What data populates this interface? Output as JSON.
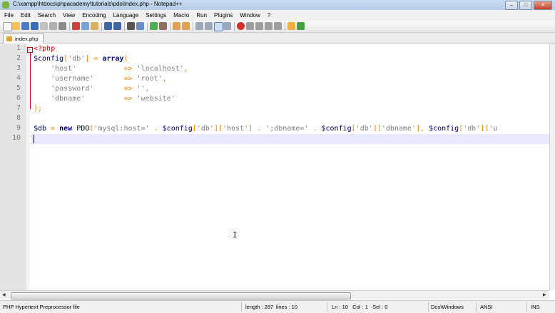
{
  "window": {
    "title": "C:\\xampp\\htdocs\\phpacademy\\tutorials\\pdo\\index.php - Notepad++",
    "controls": {
      "minimize": "–",
      "maximize": "□",
      "close": "✕"
    }
  },
  "menu": [
    "File",
    "Edit",
    "Search",
    "View",
    "Encoding",
    "Language",
    "Settings",
    "Macro",
    "Run",
    "Plugins",
    "Window",
    "?"
  ],
  "tabs": [
    {
      "label": "index.php",
      "active": true
    }
  ],
  "editor": {
    "line_numbers": [
      "1",
      "2",
      "3",
      "4",
      "5",
      "6",
      "7",
      "8",
      "9",
      "10"
    ],
    "lines": [
      [
        {
          "t": "<?php",
          "c": "php-tag"
        }
      ],
      [
        {
          "t": "$config",
          "c": "var"
        },
        {
          "t": "[",
          "c": "op"
        },
        {
          "t": "'db'",
          "c": "str"
        },
        {
          "t": "] = ",
          "c": "op"
        },
        {
          "t": "array",
          "c": "kw"
        },
        {
          "t": "(",
          "c": "op"
        }
      ],
      [
        {
          "t": "    ",
          "c": "fn"
        },
        {
          "t": "'host'",
          "c": "str"
        },
        {
          "t": "           ",
          "c": "fn"
        },
        {
          "t": "=>",
          "c": "op"
        },
        {
          "t": " ",
          "c": "fn"
        },
        {
          "t": "'localhost'",
          "c": "str"
        },
        {
          "t": ",",
          "c": "op"
        }
      ],
      [
        {
          "t": "    ",
          "c": "fn"
        },
        {
          "t": "'username'",
          "c": "str"
        },
        {
          "t": "       ",
          "c": "fn"
        },
        {
          "t": "=>",
          "c": "op"
        },
        {
          "t": " ",
          "c": "fn"
        },
        {
          "t": "'root'",
          "c": "str"
        },
        {
          "t": ",",
          "c": "op"
        }
      ],
      [
        {
          "t": "    ",
          "c": "fn"
        },
        {
          "t": "'password'",
          "c": "str"
        },
        {
          "t": "       ",
          "c": "fn"
        },
        {
          "t": "=>",
          "c": "op"
        },
        {
          "t": " ",
          "c": "fn"
        },
        {
          "t": "''",
          "c": "str"
        },
        {
          "t": ",",
          "c": "op"
        }
      ],
      [
        {
          "t": "    ",
          "c": "fn"
        },
        {
          "t": "'dbname'",
          "c": "str"
        },
        {
          "t": "         ",
          "c": "fn"
        },
        {
          "t": "=>",
          "c": "op"
        },
        {
          "t": " ",
          "c": "fn"
        },
        {
          "t": "'website'",
          "c": "str"
        }
      ],
      [
        {
          "t": ");",
          "c": "op"
        }
      ],
      [],
      [
        {
          "t": "$db",
          "c": "var"
        },
        {
          "t": " = ",
          "c": "op"
        },
        {
          "t": "new",
          "c": "kw"
        },
        {
          "t": " PDO",
          "c": "fn"
        },
        {
          "t": "(",
          "c": "op"
        },
        {
          "t": "'mysql:host='",
          "c": "str"
        },
        {
          "t": " . ",
          "c": "op"
        },
        {
          "t": "$config",
          "c": "var"
        },
        {
          "t": "[",
          "c": "op"
        },
        {
          "t": "'db'",
          "c": "str"
        },
        {
          "t": "][",
          "c": "op"
        },
        {
          "t": "'host'",
          "c": "str"
        },
        {
          "t": "] . ",
          "c": "op"
        },
        {
          "t": "';dbname='",
          "c": "str"
        },
        {
          "t": " . ",
          "c": "op"
        },
        {
          "t": "$config",
          "c": "var"
        },
        {
          "t": "[",
          "c": "op"
        },
        {
          "t": "'db'",
          "c": "str"
        },
        {
          "t": "][",
          "c": "op"
        },
        {
          "t": "'dbname'",
          "c": "str"
        },
        {
          "t": "], ",
          "c": "op"
        },
        {
          "t": "$config",
          "c": "var"
        },
        {
          "t": "[",
          "c": "op"
        },
        {
          "t": "'db'",
          "c": "str"
        },
        {
          "t": "][",
          "c": "op"
        },
        {
          "t": "'u",
          "c": "str"
        }
      ],
      []
    ]
  },
  "status": {
    "file_type": "PHP Hypertext Preprocessor file",
    "length": "length : 287",
    "lines": "lines : 10",
    "position": "Ln : 10   Col : 1   Sel : 0",
    "eol": "Dos\\Windows",
    "encoding": "ANSI",
    "insert_mode": "INS"
  },
  "colors": {
    "keyword": "#000080",
    "string": "#808080",
    "operator": "#ff8000",
    "php_tag": "#ff0000",
    "current_line": "#e8e8ff"
  }
}
